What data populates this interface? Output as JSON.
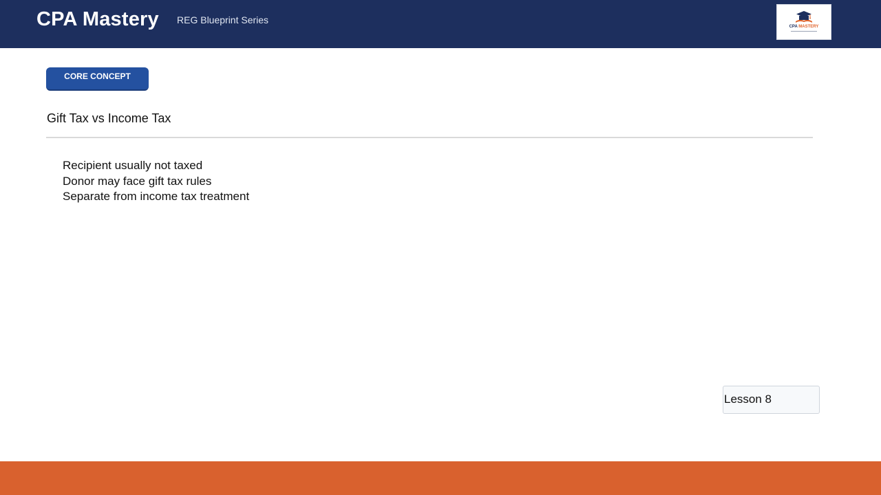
{
  "header": {
    "brand_title": "CPA Mastery",
    "series_label": "REG Blueprint Series",
    "logo": {
      "text_primary": "CPA",
      "text_accent": "MASTERY",
      "icon": "graduation-cap-book-icon"
    }
  },
  "slide": {
    "badge_label": "CORE CONCEPT",
    "title": "Gift Tax vs Income Tax",
    "bullets": [
      "Recipient usually not taxed",
      "Donor may face gift tax rules",
      "Separate from income tax treatment"
    ],
    "lesson_label": "Lesson 8"
  },
  "colors": {
    "header_bg": "#1d2f5e",
    "badge_bg": "#2451a0",
    "footer_bg": "#d9612e",
    "accent": "#e0642c"
  }
}
